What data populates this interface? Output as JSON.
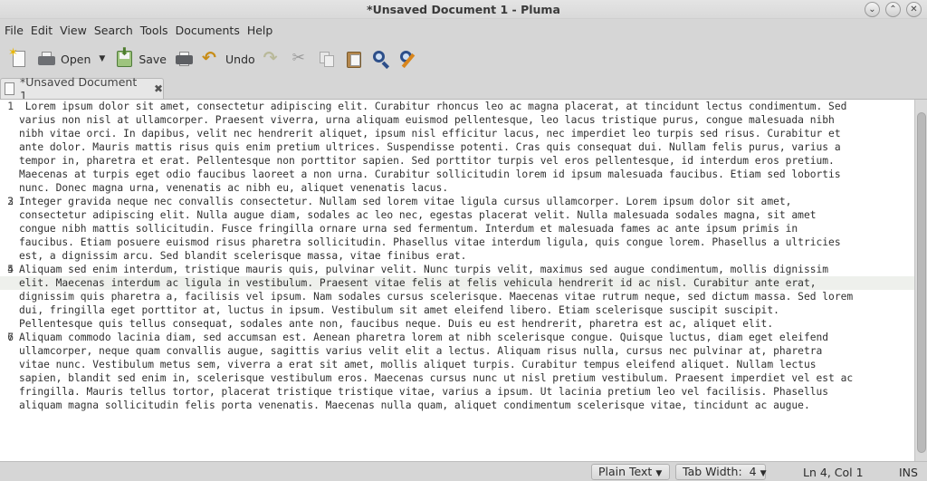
{
  "window": {
    "title": "*Unsaved Document 1 - Pluma"
  },
  "menubar": {
    "items": [
      "File",
      "Edit",
      "View",
      "Search",
      "Tools",
      "Documents",
      "Help"
    ]
  },
  "toolbar": {
    "open_label": "Open",
    "save_label": "Save",
    "undo_label": "Undo"
  },
  "tab": {
    "label": "*Unsaved Document 1"
  },
  "editor": {
    "current_line": 4,
    "lines": [
      {
        "num": "1",
        "text": " Lorem ipsum dolor sit amet, consectetur adipiscing elit. Curabitur rhoncus leo ac magna placerat, at tincidunt lectus condimentum. Sed"
      },
      {
        "num": "",
        "text": "varius non nisl at ullamcorper. Praesent viverra, urna aliquam euismod pellentesque, leo lacus tristique purus, congue malesuada nibh"
      },
      {
        "num": "",
        "text": "nibh vitae orci. In dapibus, velit nec hendrerit aliquet, ipsum nisl efficitur lacus, nec imperdiet leo turpis sed risus. Curabitur et"
      },
      {
        "num": "",
        "text": "ante dolor. Mauris mattis risus quis enim pretium ultrices. Suspendisse potenti. Cras quis consequat dui. Nullam felis purus, varius a"
      },
      {
        "num": "",
        "text": "tempor in, pharetra et erat. Pellentesque non porttitor sapien. Sed porttitor turpis vel eros pellentesque, id interdum eros pretium."
      },
      {
        "num": "",
        "text": "Maecenas at turpis eget odio faucibus laoreet a non urna. Curabitur sollicitudin lorem id ipsum malesuada faucibus. Etiam sed lobortis"
      },
      {
        "num": "",
        "text": "nunc. Donec magna urna, venenatis ac nibh eu, aliquet venenatis lacus."
      },
      {
        "num": "2",
        "text": ""
      },
      {
        "num": "3",
        "text": "Integer gravida neque nec convallis consectetur. Nullam sed lorem vitae ligula cursus ullamcorper. Lorem ipsum dolor sit amet,"
      },
      {
        "num": "",
        "text": "consectetur adipiscing elit. Nulla augue diam, sodales ac leo nec, egestas placerat velit. Nulla malesuada sodales magna, sit amet"
      },
      {
        "num": "",
        "text": "congue nibh mattis sollicitudin. Fusce fringilla ornare urna sed fermentum. Interdum et malesuada fames ac ante ipsum primis in"
      },
      {
        "num": "",
        "text": "faucibus. Etiam posuere euismod risus pharetra sollicitudin. Phasellus vitae interdum ligula, quis congue lorem. Phasellus a ultricies"
      },
      {
        "num": "",
        "text": "est, a dignissim arcu. Sed blandit scelerisque massa, vitae finibus erat."
      },
      {
        "num": "4",
        "text": ""
      },
      {
        "num": "5",
        "text": "Aliquam sed enim interdum, tristique mauris quis, pulvinar velit. Nunc turpis velit, maximus sed augue condimentum, mollis dignissim"
      },
      {
        "num": "",
        "text": "elit. Maecenas interdum ac ligula in vestibulum. Praesent vitae felis at felis vehicula hendrerit id ac nisl. Curabitur ante erat,"
      },
      {
        "num": "",
        "text": "dignissim quis pharetra a, facilisis vel ipsum. Nam sodales cursus scelerisque. Maecenas vitae rutrum neque, sed dictum massa. Sed lorem"
      },
      {
        "num": "",
        "text": "dui, fringilla eget porttitor at, luctus in ipsum. Vestibulum sit amet eleifend libero. Etiam scelerisque suscipit suscipit."
      },
      {
        "num": "",
        "text": "Pellentesque quis tellus consequat, sodales ante non, faucibus neque. Duis eu est hendrerit, pharetra est ac, aliquet elit."
      },
      {
        "num": "6",
        "text": ""
      },
      {
        "num": "7",
        "text": "Aliquam commodo lacinia diam, sed accumsan est. Aenean pharetra lorem at nibh scelerisque congue. Quisque luctus, diam eget eleifend"
      },
      {
        "num": "",
        "text": "ullamcorper, neque quam convallis augue, sagittis varius velit elit a lectus. Aliquam risus nulla, cursus nec pulvinar at, pharetra"
      },
      {
        "num": "",
        "text": "vitae nunc. Vestibulum metus sem, viverra a erat sit amet, mollis aliquet turpis. Curabitur tempus eleifend aliquet. Nullam lectus"
      },
      {
        "num": "",
        "text": "sapien, blandit sed enim in, scelerisque vestibulum eros. Maecenas cursus nunc ut nisl pretium vestibulum. Praesent imperdiet vel est ac"
      },
      {
        "num": "",
        "text": "fringilla. Mauris tellus tortor, placerat tristique tristique vitae, varius a ipsum. Ut lacinia pretium leo vel facilisis. Phasellus"
      },
      {
        "num": "",
        "text": "aliquam magna sollicitudin felis porta venenatis. Maecenas nulla quam, aliquet condimentum scelerisque vitae, tincidunt ac augue."
      }
    ]
  },
  "statusbar": {
    "language": "Plain Text",
    "tab_width": "Tab Width:  4",
    "position": "Ln 4, Col 1",
    "mode": "INS"
  }
}
